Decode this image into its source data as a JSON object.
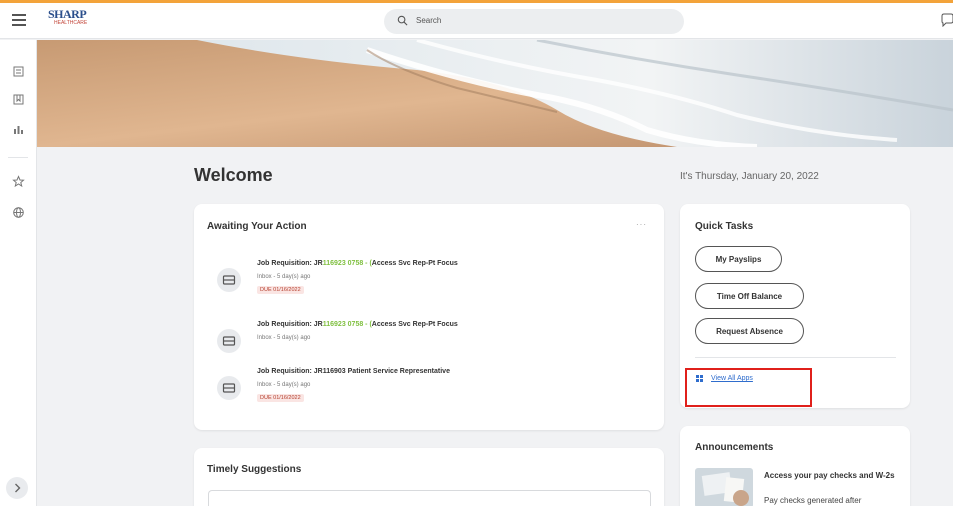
{
  "header": {
    "logo": {
      "name": "SHARP",
      "subtext": "HEALTHCARE"
    },
    "search": {
      "placeholder": "Search",
      "icon": "search-icon"
    },
    "right_icon": "chat-icon"
  },
  "sidebar": {
    "icons": [
      "inbox-icon",
      "bookmark-icon",
      "chart-icon",
      "star-icon",
      "globe-icon"
    ],
    "expand_icon": "chevron-right-icon"
  },
  "main": {
    "welcome": "Welcome",
    "date": "It's Thursday, January 20, 2022"
  },
  "awaiting": {
    "title": "Awaiting Your Action",
    "more": "···",
    "items": [
      {
        "title_prefix": "Job Requisition: JR",
        "title_highlight": "116923 0758 - (",
        "title_suffix": "Access Svc Rep-Pt Focus",
        "subtitle": "Inbox - 5 day(s) ago",
        "due": "DUE 01/16/2022"
      },
      {
        "title_prefix": "Job Requisition: JR",
        "title_highlight": "116923 0758 - (",
        "title_suffix": "Access Svc Rep-Pt Focus",
        "subtitle": "Inbox - 5 day(s) ago",
        "due": ""
      },
      {
        "title_prefix": "Job Requisition: JR116903 Patient Service Representative",
        "title_highlight": "",
        "title_suffix": "",
        "subtitle": "Inbox - 5 day(s) ago",
        "due": "DUE 01/16/2022"
      }
    ]
  },
  "quick_tasks": {
    "title": "Quick Tasks",
    "buttons": [
      "My Payslips",
      "Time Off Balance",
      "Request Absence"
    ],
    "view_all": "View All Apps"
  },
  "timely": {
    "title": "Timely Suggestions"
  },
  "announcements": {
    "title": "Announcements",
    "item_title": "Access your pay checks and W-2s",
    "item_body": "Pay checks generated after"
  },
  "colors": {
    "accent_top": "#f3a33a",
    "highlight_green": "#7fbf3f",
    "link_blue": "#2f6dcd",
    "due_red": "#b5402f",
    "annotation_red": "#e0201b"
  }
}
